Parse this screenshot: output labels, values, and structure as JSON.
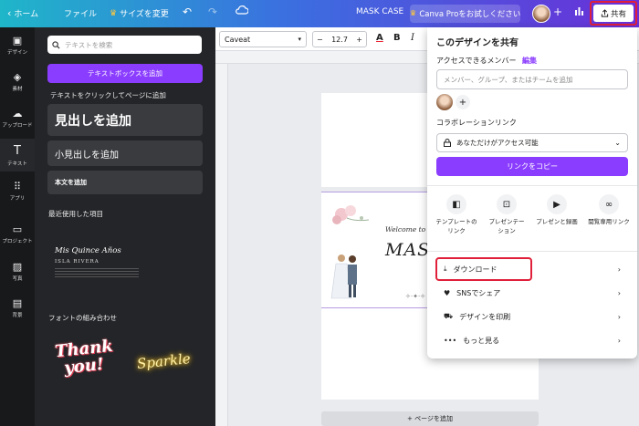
{
  "topbar": {
    "back_label": "ホーム",
    "file_label": "ファイル",
    "resize_label": "サイズを変更",
    "crown_glyph": "♛",
    "doc_title": "MASK CASE",
    "pro_label": "Canva Proをお試しください",
    "share_label": "共有"
  },
  "rail": {
    "items": [
      {
        "label": "デザイン",
        "icon": "design-icon"
      },
      {
        "label": "素材",
        "icon": "elements-icon"
      },
      {
        "label": "アップロード",
        "icon": "upload-icon"
      },
      {
        "label": "テキスト",
        "icon": "text-icon"
      },
      {
        "label": "アプリ",
        "icon": "apps-icon"
      },
      {
        "label": "プロジェクト",
        "icon": "folder-icon"
      },
      {
        "label": "写真",
        "icon": "photo-icon"
      },
      {
        "label": "背景",
        "icon": "background-icon"
      }
    ]
  },
  "panel": {
    "search_placeholder": "テキストを検索",
    "add_textbox": "テキストボックスを追加",
    "hint": "テキストをクリックしてページに追加",
    "heading": "見出しを追加",
    "subheading": "小見出しを追加",
    "body": "本文を追加",
    "recent_title": "最近使用した項目",
    "recent_item_title": "Mis Quince Años",
    "recent_item_sub": "ISLA RIVERA",
    "combos_title": "フォントの組み合わせ",
    "combo1_line1": "Thank",
    "combo1_line2": "you!",
    "combo2": "Sparkle"
  },
  "toolbar": {
    "font": "Caveat",
    "size": "12.7",
    "minus": "−",
    "plus": "+",
    "text_color_glyph": "A",
    "bold_glyph": "B",
    "italic_glyph": "I"
  },
  "canvas": {
    "welcome": "Welcome to ou",
    "title": "MASK",
    "add_page": "+ ページを追加"
  },
  "share_menu": {
    "title": "このデザインを共有",
    "access_label": "アクセスできるメンバー",
    "edit_link": "編集",
    "member_placeholder": "メンバー、グループ、またはチームを追加",
    "collab_label": "コラボレーションリンク",
    "access_value": "あなただけがアクセス可能",
    "copy_link": "リンクをコピー",
    "options": [
      {
        "line1": "テンプレートの",
        "line2": "リンク",
        "icon": "template-icon"
      },
      {
        "line1": "プレゼンテー",
        "line2": "ション",
        "icon": "present-icon"
      },
      {
        "line1": "プレゼンと録画",
        "line2": "",
        "icon": "record-icon"
      },
      {
        "line1": "閲覧専用リンク",
        "line2": "",
        "icon": "link-icon"
      }
    ],
    "menu": [
      {
        "label": "ダウンロード",
        "icon": "download-icon"
      },
      {
        "label": "SNSでシェア",
        "icon": "heart-icon"
      },
      {
        "label": "デザインを印刷",
        "icon": "truck-icon"
      },
      {
        "label": "もっと見る",
        "icon": "more-icon"
      }
    ]
  },
  "colors": {
    "accent": "#8b3dff",
    "highlight": "#e0203a"
  }
}
